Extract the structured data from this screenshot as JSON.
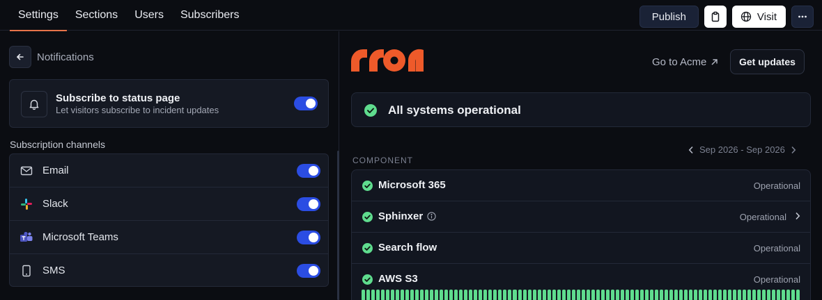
{
  "topbar": {
    "tabs": [
      {
        "label": "Settings",
        "active": true
      },
      {
        "label": "Sections",
        "active": false
      },
      {
        "label": "Users",
        "active": false
      },
      {
        "label": "Subscribers",
        "active": false
      }
    ],
    "publish_label": "Publish",
    "visit_label": "Visit"
  },
  "left": {
    "back_label": "Notifications",
    "subscribe": {
      "title": "Subscribe to status page",
      "description": "Let visitors subscribe to incident updates",
      "enabled": true
    },
    "channels_label": "Subscription channels",
    "channels": [
      {
        "label": "Email",
        "icon": "mail-icon",
        "enabled": true
      },
      {
        "label": "Slack",
        "icon": "slack-icon",
        "enabled": true
      },
      {
        "label": "Microsoft Teams",
        "icon": "teams-icon",
        "enabled": true
      },
      {
        "label": "SMS",
        "icon": "phone-icon",
        "enabled": true
      }
    ]
  },
  "preview": {
    "goto_label": "Go to Acme",
    "get_updates_label": "Get updates",
    "overall_status": "All systems operational",
    "date_range": "Sep 2026 - Sep 2026",
    "component_header": "COMPONENT",
    "components": [
      {
        "name": "Microsoft 365",
        "status": "Operational",
        "info": false,
        "chevron": false
      },
      {
        "name": "Sphinxer",
        "status": "Operational",
        "info": true,
        "chevron": true
      },
      {
        "name": "Search flow",
        "status": "Operational",
        "info": false,
        "chevron": false
      },
      {
        "name": "AWS S3",
        "status": "Operational",
        "info": false,
        "chevron": false
      }
    ]
  },
  "colors": {
    "accent_orange": "#e8744a",
    "logo_orange": "#ee5a2a",
    "toggle_blue": "#2b4de3",
    "success_green": "#5fdc8e"
  }
}
